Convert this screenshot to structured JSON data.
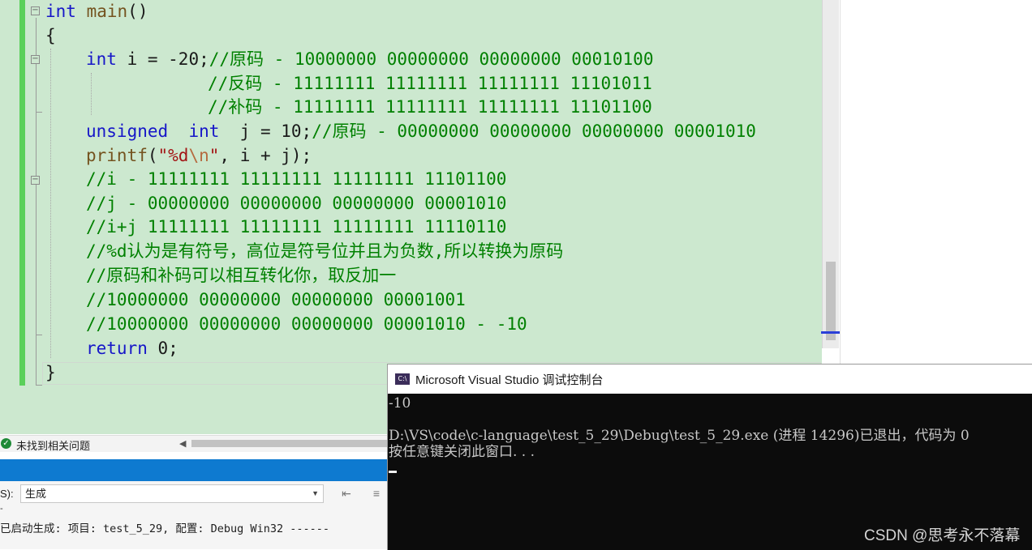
{
  "editor": {
    "lines": [
      [
        "int",
        " ",
        "main",
        "()"
      ],
      [
        "{"
      ],
      [
        "int",
        " i = -20;",
        "//原码 - 10000000 00000000 00000000 00010100"
      ],
      [
        "//反码 - 11111111 11111111 11111111 11101011"
      ],
      [
        "//补码 - 11111111 11111111 11111111 11101100"
      ],
      [
        "unsigned",
        "  ",
        "int",
        "  j = 10;",
        "//原码 - 00000000 00000000 00000000 00001010"
      ],
      [
        "printf",
        "(",
        "\"%d",
        "\\n",
        "\"",
        ", i + j);"
      ],
      [
        "//i - 11111111 11111111 11111111 11101100"
      ],
      [
        "//j - 00000000 00000000 00000000 00001010"
      ],
      [
        "//i+j 11111111 11111111 11111111 11110110"
      ],
      [
        "//%d认为是有符号，高位是符号位并且为负数,所以转换为原码"
      ],
      [
        "//原码和补码可以相互转化你，取反加一"
      ],
      [
        "//10000000 00000000 00000000 00001001"
      ],
      [
        "//10000000 00000000 00000000 00001010 - -10"
      ],
      [
        "return",
        " 0;"
      ],
      [
        "}"
      ]
    ],
    "fold_marker": "−"
  },
  "status": {
    "ok_icon": "✓",
    "text": "未找到相关问题",
    "scroll_left_arrow": "◀"
  },
  "output": {
    "source_label": "S):",
    "source_value": "生成",
    "dropdown_arrow": "▼",
    "dash_mark": "-",
    "build_line": "已启动生成: 项目: test_5_29, 配置: Debug Win32 ------"
  },
  "console": {
    "app_icon": "C:\\",
    "title": "Microsoft Visual Studio 调试控制台",
    "lines": [
      "-10",
      "",
      "D:\\VS\\code\\c-language\\test_5_29\\Debug\\test_5_29.exe (进程 14296)已退出，代码为 0",
      "按任意键关闭此窗口. . ."
    ],
    "watermark": "CSDN @思考永不落幕"
  }
}
